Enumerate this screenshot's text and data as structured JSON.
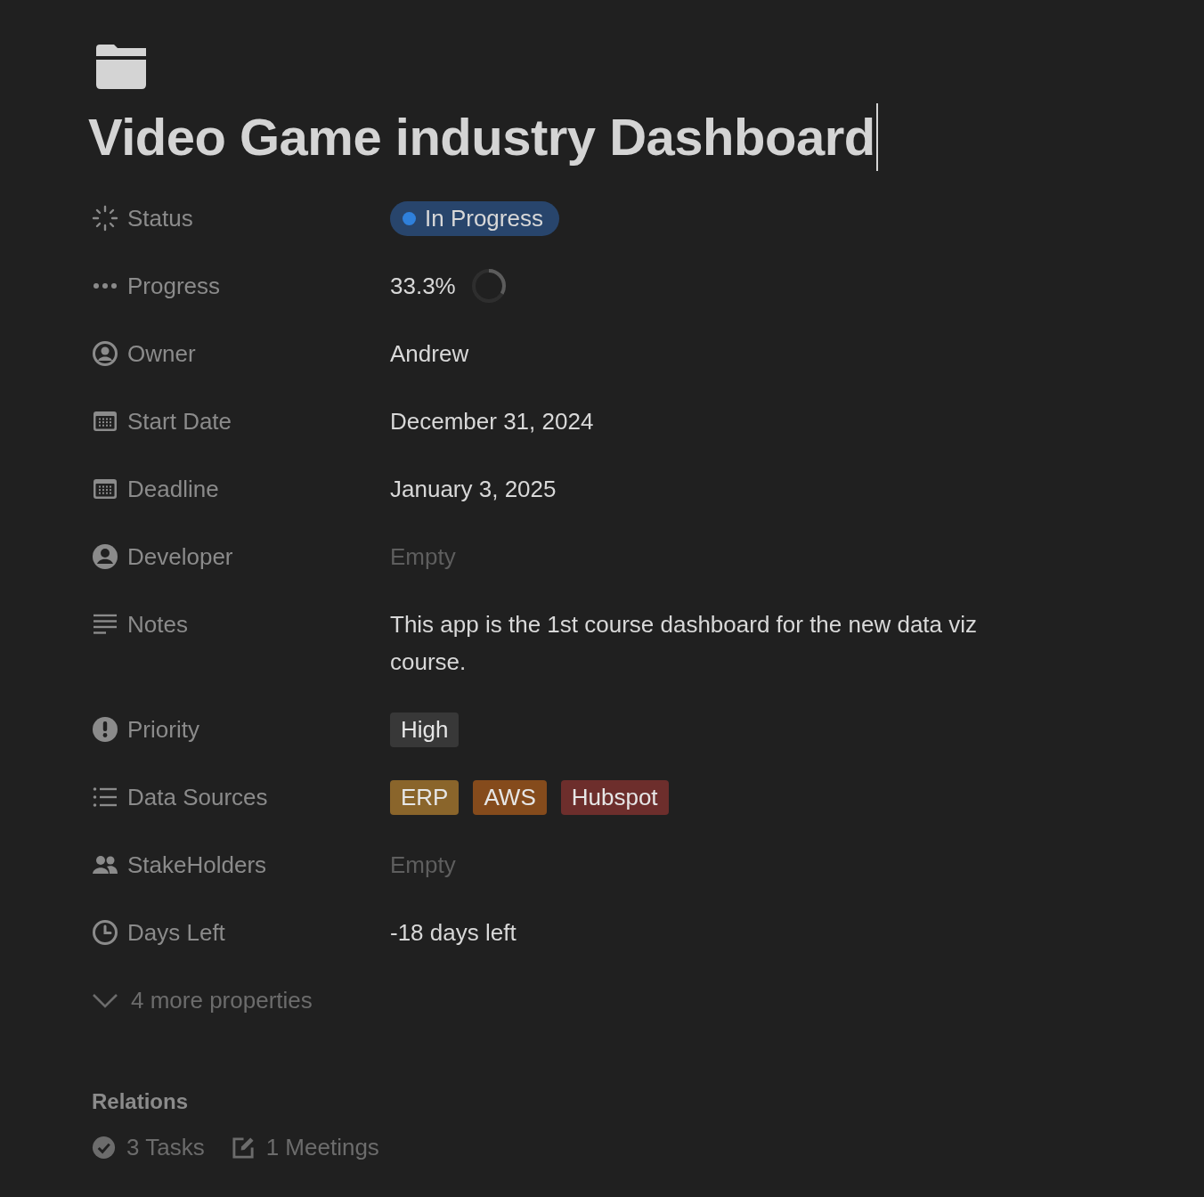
{
  "page": {
    "title": "Video Game industry Dashboard"
  },
  "properties": [
    {
      "label": "Status",
      "kind": "status",
      "value": "In Progress"
    },
    {
      "label": "Progress",
      "kind": "progress",
      "value": "33.3%",
      "level": 0.333
    },
    {
      "label": "Owner",
      "kind": "text",
      "value": "Andrew"
    },
    {
      "label": "Start Date",
      "kind": "text",
      "value": "December 31, 2024"
    },
    {
      "label": "Deadline",
      "kind": "text",
      "value": "January 3, 2025"
    },
    {
      "label": "Developer",
      "kind": "empty",
      "placeholder": "Empty"
    },
    {
      "label": "Notes",
      "kind": "text",
      "value": "This app is the 1st course dashboard for the new data viz course."
    },
    {
      "label": "Priority",
      "kind": "tags",
      "tags": [
        {
          "text": "High",
          "color": "#383838"
        }
      ]
    },
    {
      "label": "Data Sources",
      "kind": "tags",
      "tags": [
        {
          "text": "ERP",
          "color": "#8a652b"
        },
        {
          "text": "AWS",
          "color": "#854b1c"
        },
        {
          "text": "Hubspot",
          "color": "#6d2e2c"
        }
      ]
    },
    {
      "label": "StakeHolders",
      "kind": "empty",
      "placeholder": "Empty"
    },
    {
      "label": "Days Left",
      "kind": "text",
      "value": "-18 days left"
    }
  ],
  "more_properties": {
    "label": "4 more properties",
    "expanded": false
  },
  "relations": {
    "heading": "Relations",
    "items": [
      {
        "label": "3 Tasks"
      },
      {
        "label": "1 Meetings"
      }
    ]
  }
}
